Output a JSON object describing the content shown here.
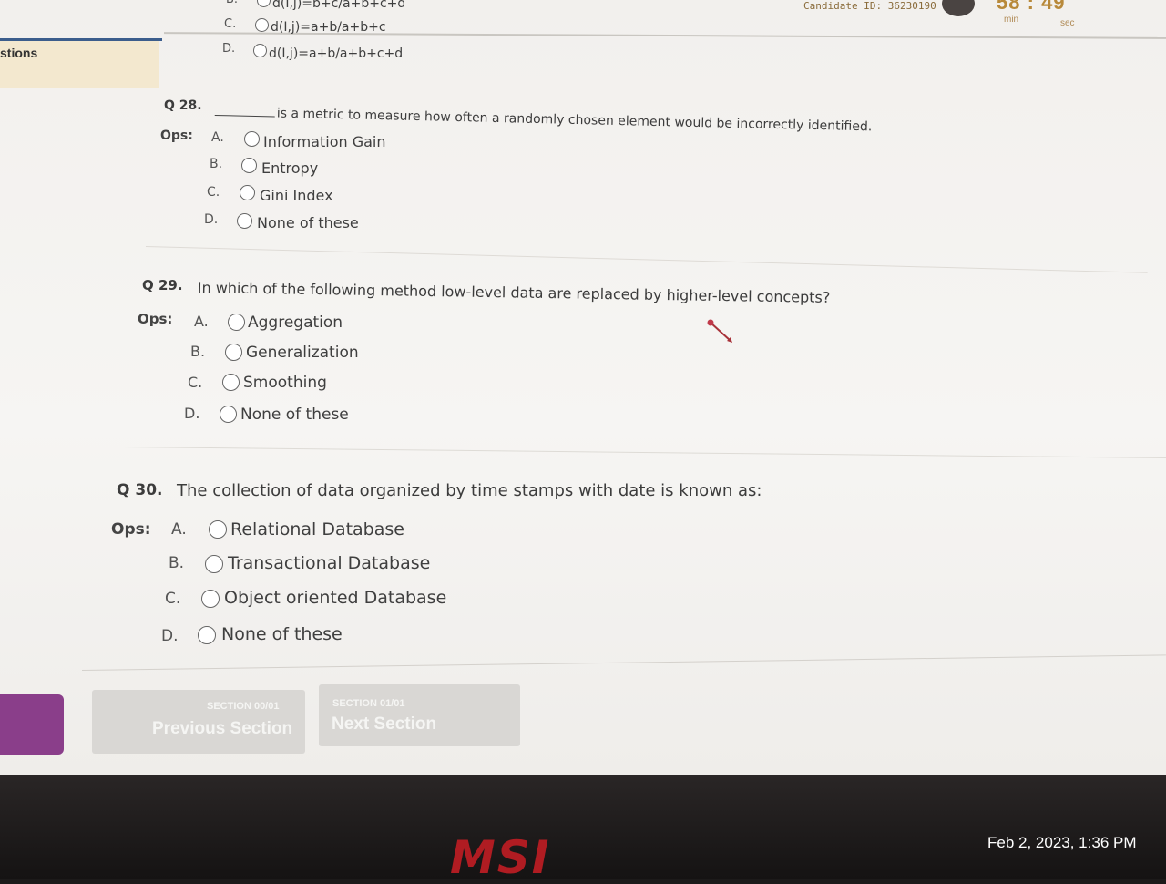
{
  "header": {
    "candidate_id": "Candidate ID: 36230190",
    "timer_min": "58",
    "timer_sep": ":",
    "timer_sec": "49",
    "min_label": "min",
    "sec_label": "sec"
  },
  "sidebar": {
    "label": "stions"
  },
  "prev_question": {
    "options": [
      {
        "letter": "B.",
        "text": "d(I,j)=b+c/a+b+c+d"
      },
      {
        "letter": "C.",
        "text": "d(I,j)=a+b/a+b+c"
      },
      {
        "letter": "D.",
        "text": "d(I,j)=a+b/a+b+c+d"
      }
    ]
  },
  "questions": [
    {
      "number": "Q 28.",
      "text": "is a metric to measure how often a randomly chosen element would be incorrectly identified.",
      "ops_label": "Ops:",
      "options": [
        {
          "letter": "A.",
          "text": "Information Gain"
        },
        {
          "letter": "B.",
          "text": "Entropy"
        },
        {
          "letter": "C.",
          "text": "Gini Index"
        },
        {
          "letter": "D.",
          "text": "None of these"
        }
      ]
    },
    {
      "number": "Q 29.",
      "text": "In which of the following method low-level data are replaced by higher-level concepts?",
      "ops_label": "Ops:",
      "options": [
        {
          "letter": "A.",
          "text": "Aggregation"
        },
        {
          "letter": "B.",
          "text": "Generalization"
        },
        {
          "letter": "C.",
          "text": "Smoothing"
        },
        {
          "letter": "D.",
          "text": "None of these"
        }
      ]
    },
    {
      "number": "Q 30.",
      "text": "The collection of data organized by time stamps with date is known as:",
      "ops_label": "Ops:",
      "options": [
        {
          "letter": "A.",
          "text": "Relational Database"
        },
        {
          "letter": "B.",
          "text": "Transactional Database"
        },
        {
          "letter": "C.",
          "text": "Object oriented Database"
        },
        {
          "letter": "D.",
          "text": "None of these"
        }
      ]
    }
  ],
  "nav": {
    "prev_section": "SECTION 00/01",
    "prev_label": "Previous Section",
    "next_section": "SECTION 01/01",
    "next_label": "Next Section"
  },
  "device": {
    "brand": "msi",
    "timestamp": "Feb 2, 2023, 1:36 PM"
  }
}
